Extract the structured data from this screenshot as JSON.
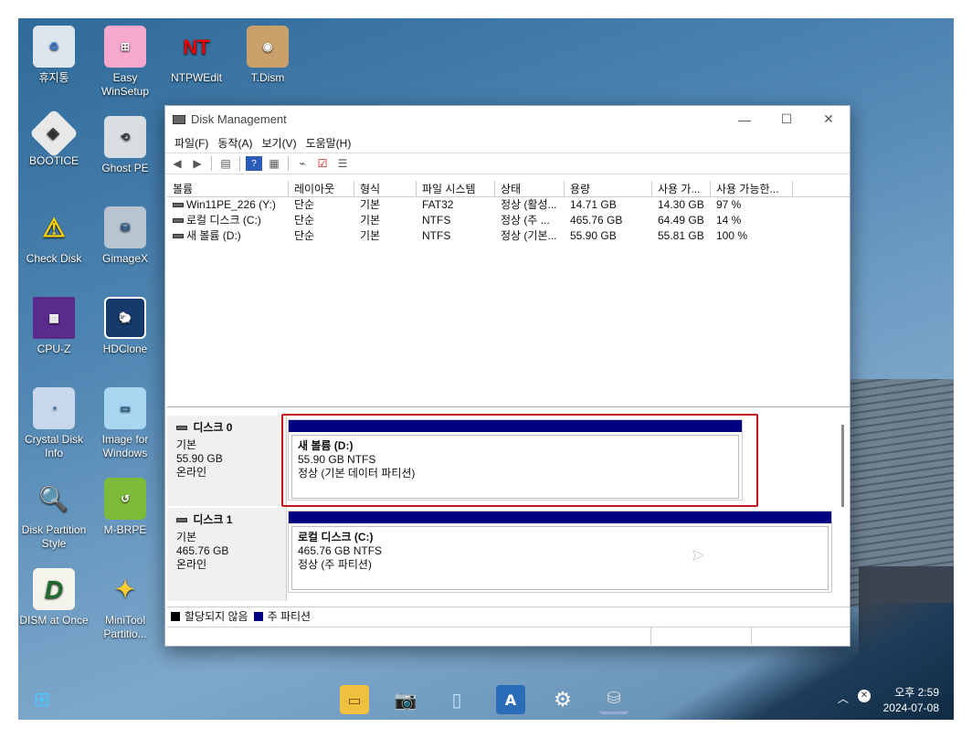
{
  "desktop": {
    "icons": [
      {
        "label": "휴지통",
        "icon": "recycle-bin"
      },
      {
        "label": "Easy WinSetup",
        "icon": "windows-logo"
      },
      {
        "label": "NTPWEdit",
        "icon": "key"
      },
      {
        "label": "T.Dism",
        "icon": "disc-box"
      },
      {
        "label": "BOOTICE",
        "icon": "floppy-disk"
      },
      {
        "label": "Ghost PE",
        "icon": "restore-drive"
      },
      {
        "label": "Check Disk",
        "icon": "warning-drive"
      },
      {
        "label": "GimageX",
        "icon": "image-drive"
      },
      {
        "label": "CPU-Z",
        "icon": "cpu-chip"
      },
      {
        "label": "HDClone",
        "icon": "sheep-drive"
      },
      {
        "label": "Crystal Disk Info",
        "icon": "crystal-disk"
      },
      {
        "label": "Image for Windows",
        "icon": "monitor-drive"
      },
      {
        "label": "Disk Partition Style",
        "icon": "magnifier-drive"
      },
      {
        "label": "M-BRPE",
        "icon": "green-board"
      },
      {
        "label": "DISM at Once",
        "icon": "letter-d"
      },
      {
        "label": "MiniTool Partitio...",
        "icon": "wand-drive"
      }
    ]
  },
  "window": {
    "title": "Disk Management",
    "controls": {
      "minimize": "—",
      "maximize": "☐",
      "close": "✕"
    },
    "menu": [
      "파일(F)",
      "동작(A)",
      "보기(V)",
      "도움말(H)"
    ],
    "columns": [
      "볼륨",
      "레이아웃",
      "형식",
      "파일 시스템",
      "상태",
      "용량",
      "사용 가...",
      "사용 가능한..."
    ],
    "volumes": [
      {
        "name": "Win11PE_226 (Y:)",
        "layout": "단순",
        "type": "기본",
        "fs": "FAT32",
        "status": "정상 (활성...",
        "capacity": "14.71 GB",
        "free": "14.30 GB",
        "pct": "97 %"
      },
      {
        "name": "로컬 디스크 (C:)",
        "layout": "단순",
        "type": "기본",
        "fs": "NTFS",
        "status": "정상 (주 ...",
        "capacity": "465.76 GB",
        "free": "64.49 GB",
        "pct": "14 %"
      },
      {
        "name": "새 볼륨 (D:)",
        "layout": "단순",
        "type": "기본",
        "fs": "NTFS",
        "status": "정상 (기본...",
        "capacity": "55.90 GB",
        "free": "55.81 GB",
        "pct": "100 %"
      }
    ],
    "disks": [
      {
        "name": "디스크 0",
        "kind": "기본",
        "size": "55.90 GB",
        "state": "온라인",
        "partition": {
          "title": "새 볼륨   (D:)",
          "size": "55.90 GB NTFS",
          "status": "정상 (기본 데이터 파티션)"
        }
      },
      {
        "name": "디스크 1",
        "kind": "기본",
        "size": "465.76 GB",
        "state": "온라인",
        "partition": {
          "title": "로컬 디스크   (C:)",
          "size": "465.76 GB NTFS",
          "status": "정상 (주 파티션)"
        }
      }
    ],
    "legend": [
      {
        "label": "할당되지 않음",
        "color": "#000000"
      },
      {
        "label": "주 파티션",
        "color": "#000080"
      }
    ]
  },
  "taskbar": {
    "time": "오후 2:59",
    "date": "2024-07-08"
  },
  "colors": {
    "accent": "#000080",
    "selection": "#c3161c"
  }
}
